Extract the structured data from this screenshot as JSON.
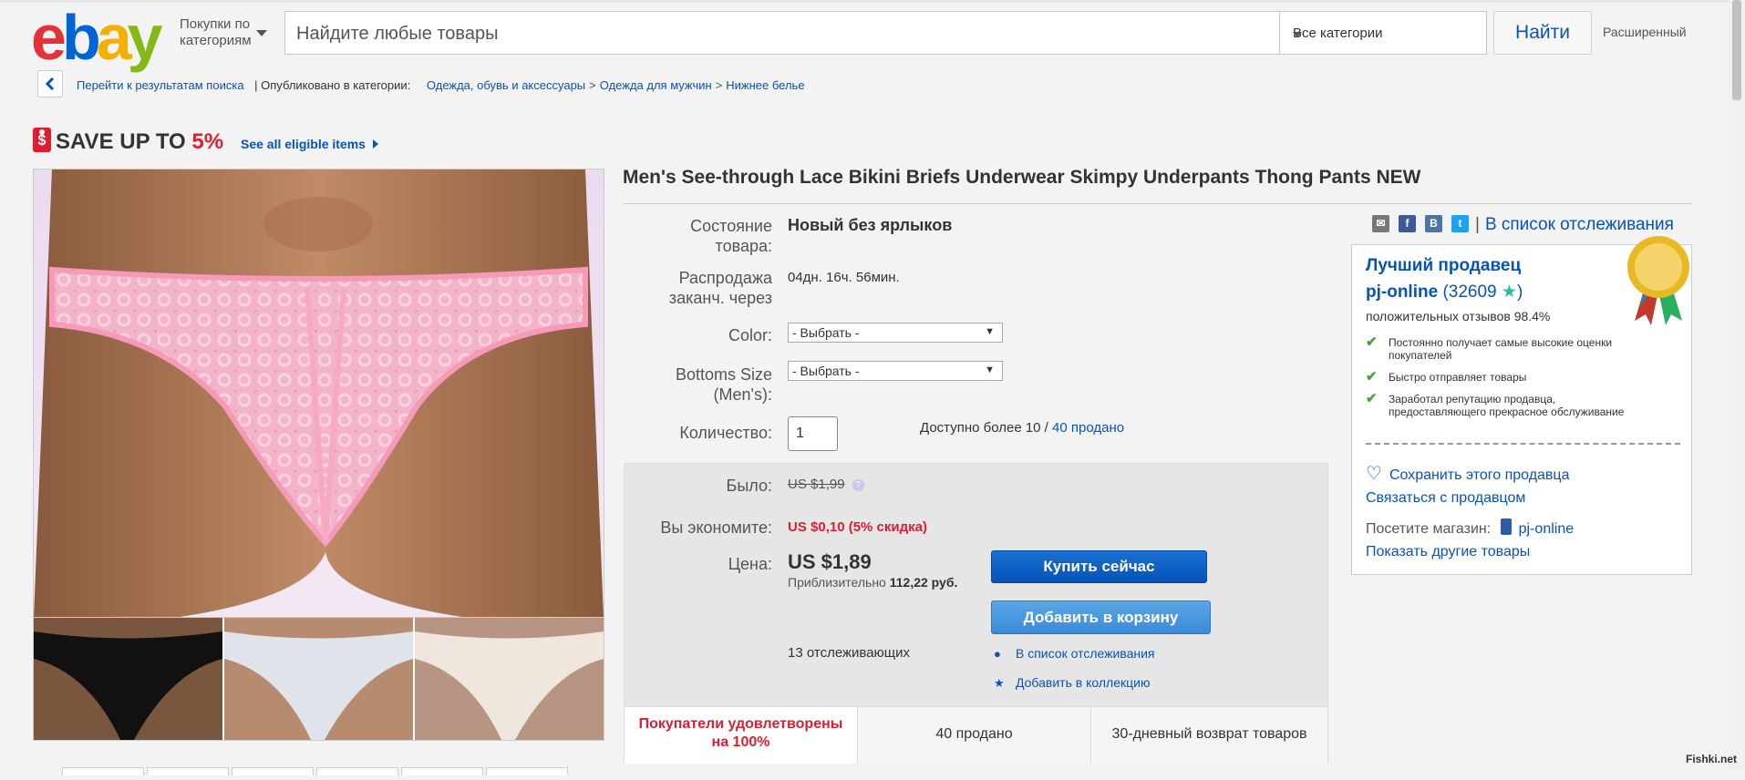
{
  "header": {
    "shop_by_category": "Покупки по\nкатегориям",
    "search_placeholder": "Найдите любые товары",
    "category_select": "Все категории",
    "search_button": "Найти",
    "advanced": "Расширенный"
  },
  "breadcrumb": {
    "back_to_results": "Перейти к результатам поиска",
    "published_in": "| Опубликовано в категории:",
    "items": [
      "Одежда, обувь и аксессуары",
      "Одежда для мужчин",
      "Нижнее белье"
    ],
    "separator": ">"
  },
  "promo": {
    "save_up_to": "SAVE UP TO",
    "percent": "5%",
    "eligible_link": "See all eligible items"
  },
  "item": {
    "title": "Men's See-through Lace Bikini Briefs Underwear Skimpy Underpants Thong Pants NEW",
    "condition_label": "Состояние\nтовара:",
    "condition_value": "Новый без ярлыков",
    "sale_ends_label": "Распродажа\nзаканч. через",
    "sale_ends_value": "04дн. 16ч. 56мин.",
    "color_label": "Color:",
    "color_select": "- Выбрать -",
    "size_label": "Bottoms Size\n(Men's):",
    "size_select": "- Выбрать -",
    "quantity_label": "Количество:",
    "quantity_value": "1",
    "available": "Доступно более 10 /",
    "sold_link": "40 продано"
  },
  "pricing": {
    "was_label": "Было:",
    "was_value": "US $1,99",
    "you_save_label": "Вы экономите:",
    "you_save_value": "US $0,10 (5% скидка)",
    "price_label": "Цена:",
    "price_value": "US $1,89",
    "approx_prefix": "Приблизительно",
    "approx_value": "112,22 руб.",
    "buy_now": "Купить сейчас",
    "add_to_cart": "Добавить в корзину",
    "watchers": "13 отслеживающих",
    "add_to_watchlist": "В список отслеживания",
    "add_to_collection": "Добавить в коллекцию"
  },
  "bottom_row": {
    "satisfied": "Покупатели удовлетворены\nна 100%",
    "sold": "40 продано",
    "returns": "30-дневный возврат товаров"
  },
  "share": {
    "watch_link": "В список отслеживания",
    "divider": "|"
  },
  "seller": {
    "top_seller": "Лучший продавец",
    "name": "pj-online",
    "feedback_count": "32609",
    "positive": "положительных отзывов 98.4%",
    "features": [
      "Постоянно получает самые высокие оценки покупателей",
      "Быстро отправляет товары",
      "Заработал репутацию продавца, предоставляющего прекрасное обслуживание"
    ],
    "save_seller": "Сохранить этого продавца",
    "contact_seller": "Связаться с продавцом",
    "visit_store_label": "Посетите магазин:",
    "store_name": "pj-online",
    "other_items": "Показать другие товары"
  },
  "watermark": "Fishki.net",
  "colors": {
    "link": "#0654ba",
    "sale_red": "#dd1e31",
    "buy_button": "#0654ba",
    "cart_button": "#3b8ad6"
  }
}
